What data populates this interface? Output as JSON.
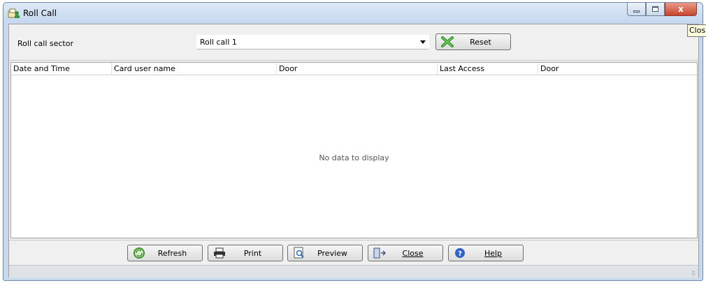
{
  "window": {
    "title": "Roll Call",
    "icon": "roll-call-icon",
    "close_symbol": "x"
  },
  "tooltip": "Close",
  "filter": {
    "label": "Roll call sector",
    "combo_value": "Roll call 1",
    "reset_label": "Reset"
  },
  "grid": {
    "columns": [
      "Date and Time",
      "Card user name",
      "Door",
      "Last Access",
      "Door"
    ],
    "empty_text": "No data to display"
  },
  "toolbar": {
    "refresh_label": "Refresh",
    "print_label": "Print",
    "preview_label": "Preview",
    "close_label": "Close",
    "help_label": "Help"
  },
  "colors": {
    "accent": "#c7452c",
    "titlebar": "#c4d7ee"
  }
}
